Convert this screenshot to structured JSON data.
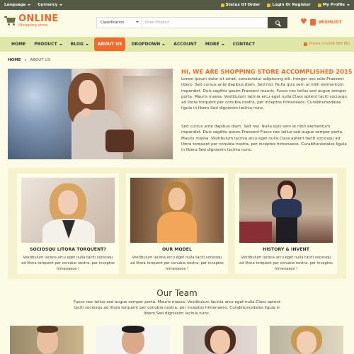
{
  "topbar": {
    "language": "Language",
    "currency": "Currency",
    "status": "Status Of Order",
    "login": "Login Or Register",
    "profile": "My Profile"
  },
  "brand": {
    "title": "ONLINE",
    "subtitle": "Shopping store"
  },
  "search": {
    "classification": "Classification",
    "placeholder": "Enter Product"
  },
  "wishlist": "WISHLIST",
  "nav": {
    "items": [
      {
        "label": "HOME",
        "dropdown": false
      },
      {
        "label": "PRODUCT",
        "dropdown": true
      },
      {
        "label": "BLOG",
        "dropdown": true
      },
      {
        "label": "ABOUT US",
        "dropdown": false,
        "active": true
      },
      {
        "label": "DROPDOWN",
        "dropdown": true
      },
      {
        "label": "ACCOUNT",
        "dropdown": false
      },
      {
        "label": "MORE",
        "dropdown": true
      },
      {
        "label": "CONTACT",
        "dropdown": false
      }
    ],
    "phone": "Phone:(+1254 567 89)"
  },
  "breadcrumb": {
    "home": "HOME",
    "current": "ABOUT US"
  },
  "about": {
    "heading": "HI, WE ARE SHOPPING STORE ACCOMPLISHED 2015",
    "para1": "Lorem ipsum dolor sit amet, consectetur adipiscing elit. Integer nec odio.Praesent libero. Sed cursus ante dapibus diam. Sed nisi. Nulla quis sem at nibh elementum imperdiet. Duis sagittis ipsum.Praesent mauris. Fusce nec tellus sed augue semper porta. Mauris massa. Vestibulum lacinia arcu eget nulla.Class aptent taciti sociosqu ad litora torquent per conubia nostra, per inceptos himenaeos. Curabitursodales ligula in libero.Sed dignissim lacinia nunc.",
    "para2": "Sed cursus ante dapibus diam. Sed nisi. Nulla quis sem at nibh elementum imperdiet. Duis sagittis ipsum.Praesent Fusce nec tellus sed augue semper porta. Mauris massa. Vestibulum lacinia arcu eget nulla.Class aptent taciti sociosqu ad litora torquent per conubia nostra, per inceptos himenaeos. Curabitursodales ligula in libero.Sed dignissim lacinia nunc."
  },
  "features": [
    {
      "title": "SOCIOSQU LITORA TORQUENT?",
      "text": "Vestibulum lacinia arcu eget nulla taciti sociosqu ad litora torquent per conubia nostra, per inceptos himenaeos !"
    },
    {
      "title": "OUR MODEL",
      "text": "Vestibulum lacinia arcu eget nulla taciti sociosqu ad litora torquent per conubia nostra, per inceptos himenaeos !"
    },
    {
      "title": "HISTORY & INVENT",
      "text": "Vestibulum lacinia arcu eget nulla taciti sociosqu ad litora torquent per conubia nostra, per inceptos himenaeos !"
    }
  ],
  "team": {
    "heading": "Our Team",
    "text": "Fusce nec tellus sed augue semper porta. Mauris massa. Vestibulum lacinia arcu eget nulla.Class aptent taciti sociosqu ad litora torquent per conubia nostra, per inceptos himenaeos. Curabitursodales ligula in libero.Sed dignissim lacinia nunc."
  },
  "colors": {
    "accent": "#ef6a2c",
    "nav": "#dde7a8",
    "topbar": "#555a45",
    "background": "#fbfbe6"
  }
}
